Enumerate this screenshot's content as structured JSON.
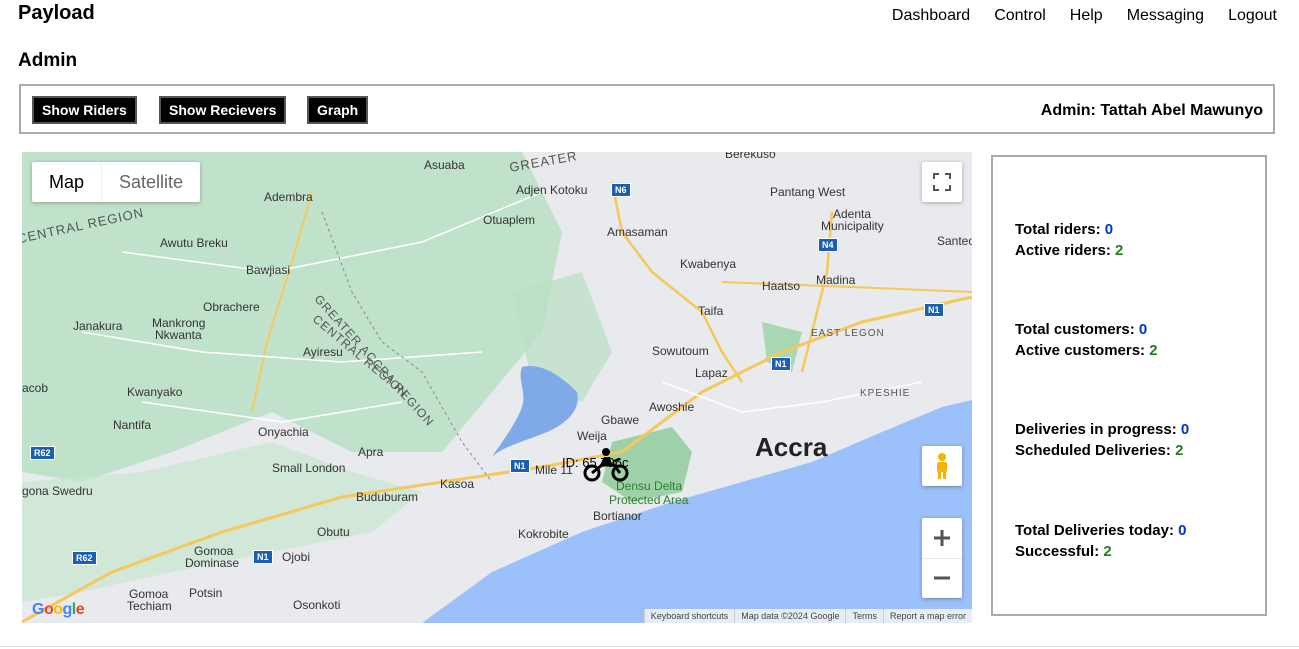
{
  "app": {
    "brand": "Payload"
  },
  "nav": [
    "Dashboard",
    "Control",
    "Help",
    "Messaging",
    "Logout"
  ],
  "page_title": "Admin",
  "toolbar": {
    "show_riders": "Show Riders",
    "show_receivers": "Show Recievers",
    "graph": "Graph",
    "admin_label": "Admin: Tattah Abel Mawunyo"
  },
  "map": {
    "type_map": "Map",
    "type_satellite": "Satellite",
    "labels": {
      "asuaba": "Asuaba",
      "greater_top": "GREATER",
      "berekuso": "Berekuso",
      "adjen_kotoku": "Adjen Kotoku",
      "pantang_west": "Pantang West",
      "adembra": "Adembra",
      "central_region_1": "CENTRAL REGION",
      "otuaplem": "Otuaplem",
      "adenta": "Adenta",
      "municipality": "Municipality",
      "amasaman": "Amasaman",
      "awutu_breku": "Awutu Breku",
      "santeo": "Santeo",
      "bawjiasi": "Bawjiasi",
      "kwabenya": "Kwabenya",
      "haatso": "Haatso",
      "madina": "Madina",
      "greater_accra_region": "GREATER ACCRA REGION",
      "obrachere": "Obrachere",
      "taifa": "Taifa",
      "central_region_2": "CENTRAL REGION",
      "janakura": "Janakura",
      "mankrong": "Mankrong",
      "nkwanta": "Nkwanta",
      "east_legon": "EAST LEGON",
      "ayiresu": "Ayiresu",
      "sowutoum": "Sowutoum",
      "lapaz": "Lapaz",
      "acob": "acob",
      "kwanyako": "Kwanyako",
      "kpeshie": "KPESHIE",
      "awoshie": "Awoshie",
      "gbawe": "Gbawe",
      "nantifa": "Nantifa",
      "onyachia": "Onyachia",
      "weija": "Weija",
      "accra": "Accra",
      "apra": "Apra",
      "mile_11": "Mile 11",
      "small_london": "Small London",
      "densu_delta_1": "Densu Delta",
      "densu_delta_2": "Protected Area",
      "gona_swedru": "gona Swedru",
      "kasoa": "Kasoa",
      "buduburam": "Buduburam",
      "bortianor": "Bortianor",
      "obutu": "Obutu",
      "kokrobite": "Kokrobite",
      "gomoa_dominase_1": "Gomoa",
      "gomoa_dominase_2": "Dominase",
      "ojobi": "Ojobi",
      "gomoa_techiam_1": "Gomoa",
      "gomoa_techiam_2": "Techiam",
      "potsin": "Potsin",
      "osonkoti": "Osonkoti"
    },
    "shields": {
      "n6": "N6",
      "n4": "N4",
      "n1_a": "N1",
      "n1_b": "N1",
      "n1_c": "N1",
      "r62_a": "R62",
      "r62_b": "R62",
      "n1_d": "N1"
    },
    "rider_label": "ID: 65 796c",
    "google": "Google",
    "attribution": [
      "Keyboard shortcuts",
      "Map data ©2024 Google",
      "Terms",
      "Report a map error"
    ]
  },
  "stats": {
    "total_riders_label": "Total riders:",
    "total_riders": "0",
    "active_riders_label": "Active riders:",
    "active_riders": "2",
    "total_customers_label": "Total customers:",
    "total_customers": "0",
    "active_customers_label": "Active customers:",
    "active_customers": "2",
    "deliveries_in_progress_label": "Deliveries in progress:",
    "deliveries_in_progress": "0",
    "scheduled_deliveries_label": "Scheduled Deliveries:",
    "scheduled_deliveries": "2",
    "total_deliveries_today_label": "Total Deliveries today:",
    "total_deliveries_today": "0",
    "successful_label": "Successful:",
    "successful": "2"
  },
  "colors": {
    "blue_value": "#0033cc",
    "green_value": "#208020",
    "sea": "#9cc0f9",
    "land": "#e8eaed",
    "forest": "#b9e0c3"
  }
}
